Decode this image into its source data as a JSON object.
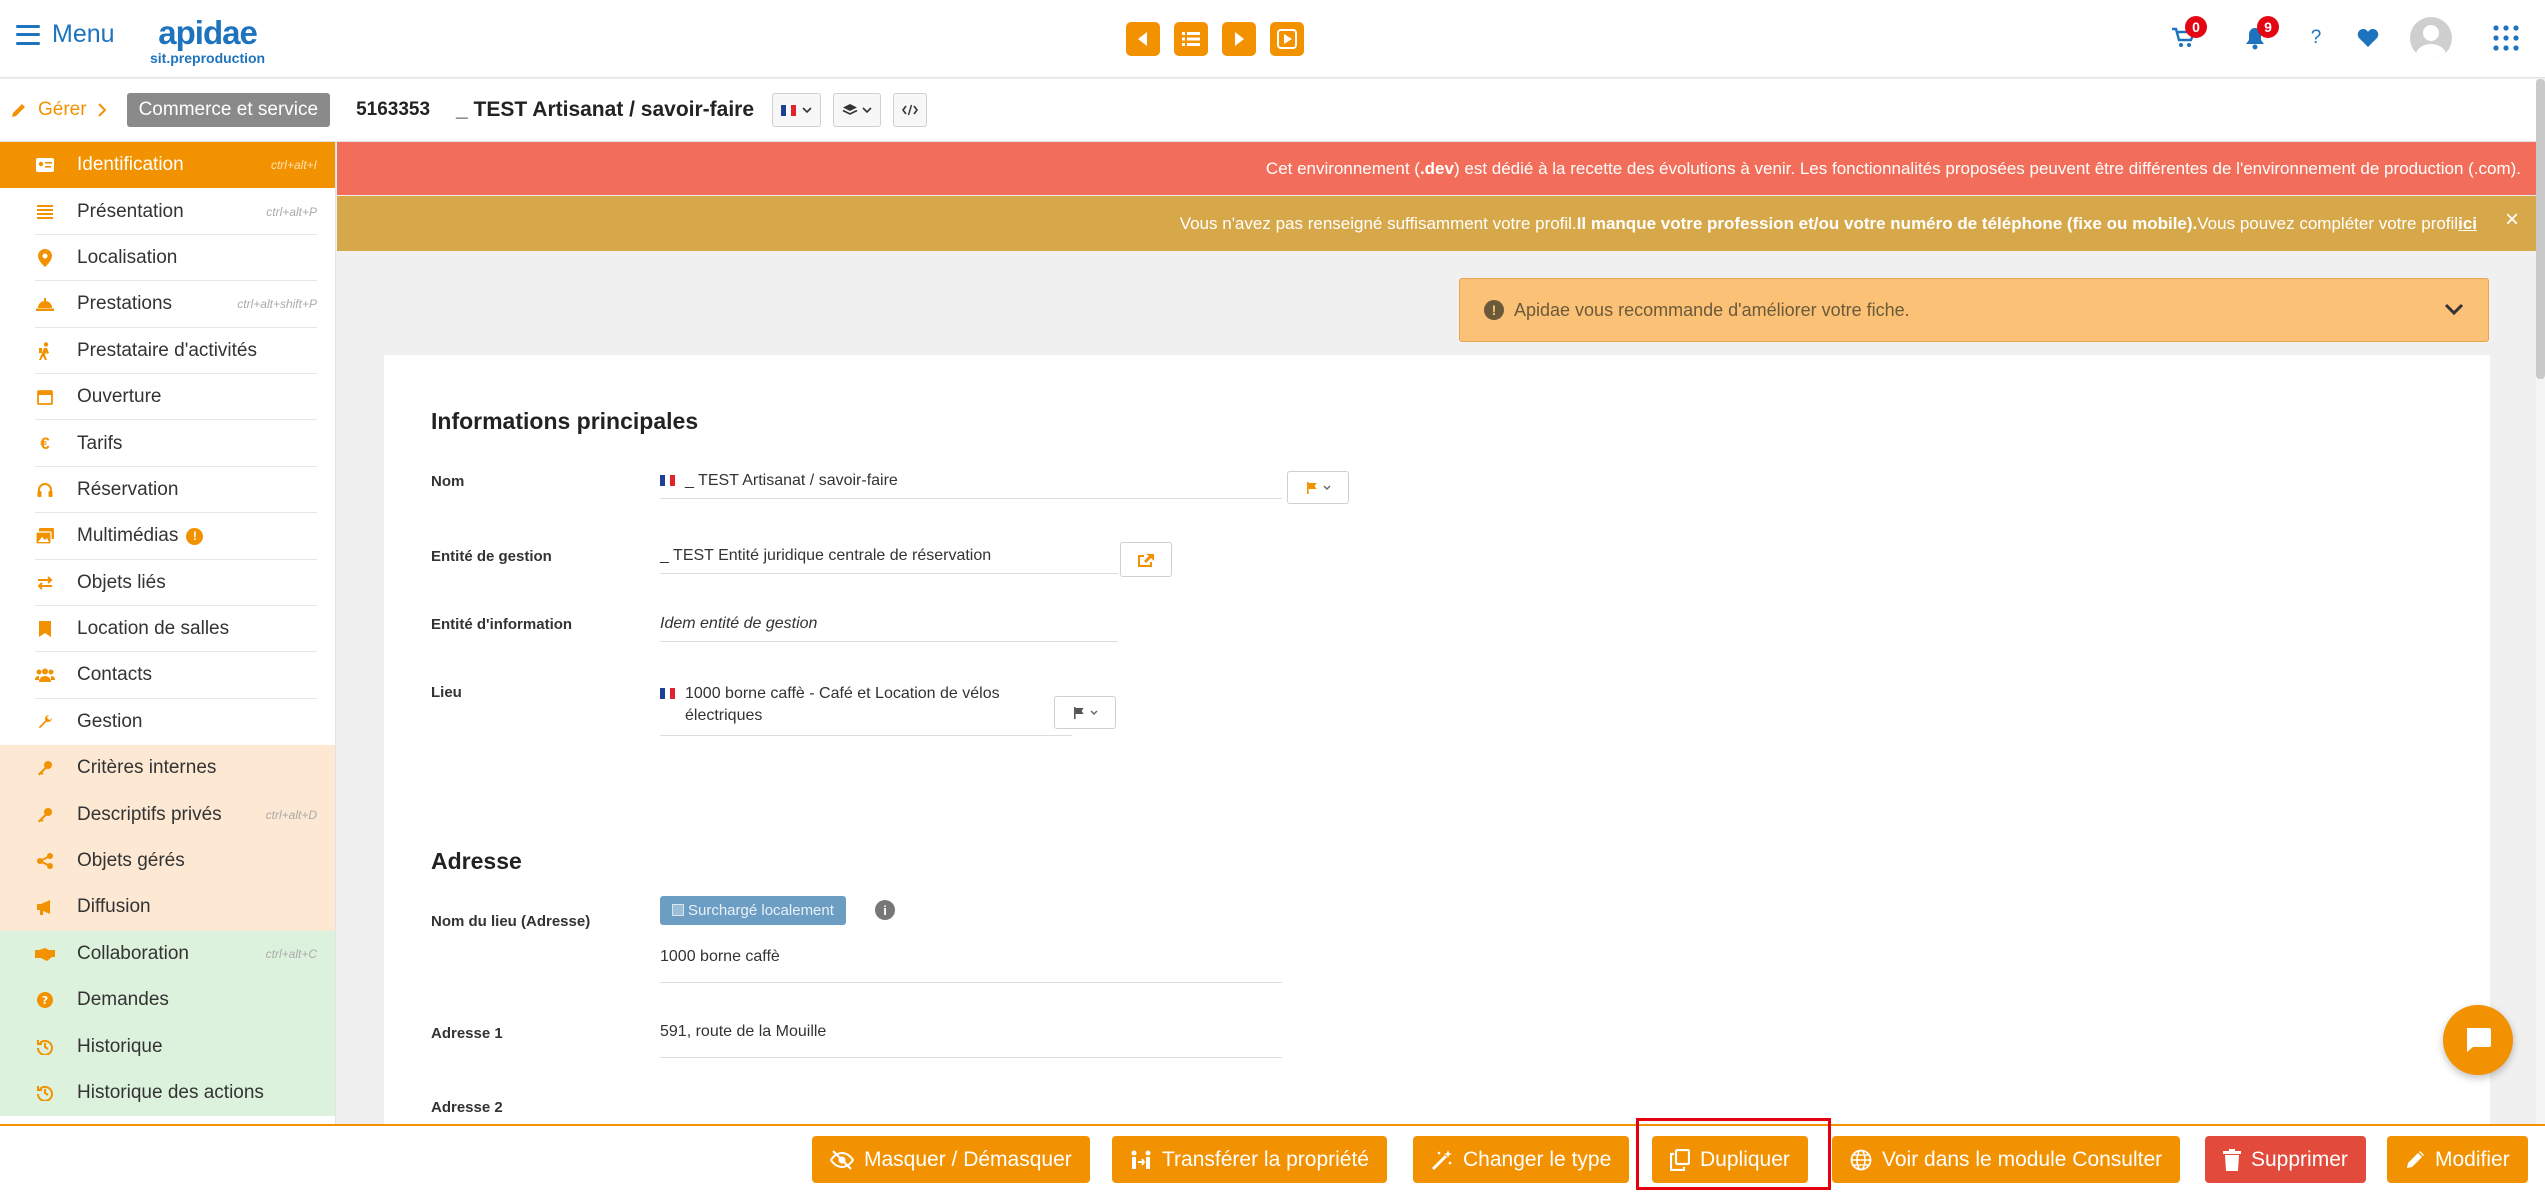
{
  "header": {
    "menu_label": "Menu",
    "logo_main": "apidae",
    "logo_sub": "sit.preproduction",
    "cart_count": "0",
    "notif_count": "9",
    "help_label": "?",
    "brand_color": "#f39200"
  },
  "subheader": {
    "manage_label": "Gérer",
    "type_label": "Commerce et service",
    "object_id": "5163353",
    "object_name": "_ TEST Artisanat / savoir-faire"
  },
  "sidebar": {
    "items": [
      {
        "label": "Identification",
        "shortcut": "ctrl+alt+I"
      },
      {
        "label": "Présentation",
        "shortcut": "ctrl+alt+P"
      },
      {
        "label": "Localisation",
        "shortcut": ""
      },
      {
        "label": "Prestations",
        "shortcut": "ctrl+alt+shift+P"
      },
      {
        "label": "Prestataire d'activités",
        "shortcut": ""
      },
      {
        "label": "Ouverture",
        "shortcut": ""
      },
      {
        "label": "Tarifs",
        "shortcut": ""
      },
      {
        "label": "Réservation",
        "shortcut": ""
      },
      {
        "label": "Multimédias",
        "shortcut": ""
      },
      {
        "label": "Objets liés",
        "shortcut": ""
      },
      {
        "label": "Location de salles",
        "shortcut": ""
      },
      {
        "label": "Contacts",
        "shortcut": ""
      },
      {
        "label": "Gestion",
        "shortcut": ""
      },
      {
        "label": "Critères internes",
        "shortcut": ""
      },
      {
        "label": "Descriptifs privés",
        "shortcut": "ctrl+alt+D"
      },
      {
        "label": "Objets gérés",
        "shortcut": ""
      },
      {
        "label": "Diffusion",
        "shortcut": ""
      },
      {
        "label": "Collaboration",
        "shortcut": "ctrl+alt+C"
      },
      {
        "label": "Demandes",
        "shortcut": ""
      },
      {
        "label": "Historique",
        "shortcut": ""
      },
      {
        "label": "Historique des actions",
        "shortcut": ""
      }
    ],
    "multimedia_badge": "!"
  },
  "banners": {
    "env_pre": "Cet environnement (",
    "env_bold": ".dev",
    "env_post": ") est dédié à la recette des évolutions à venir. Les fonctionnalités proposées peuvent être différentes de l'environnement de production (.com).",
    "profile_pre": "Vous n'avez pas renseigné suffisamment votre profil. ",
    "profile_bold": "Il manque votre profession et/ou votre numéro de téléphone (fixe ou mobile).",
    "profile_post": "Vous pouvez compléter votre profil ",
    "profile_link": "ici",
    "close_label": "×",
    "recommendation": "Apidae vous recommande d'améliorer votre fiche."
  },
  "form": {
    "section_main": "Informations principales",
    "nom_label": "Nom",
    "nom_value": "_ TEST Artisanat / savoir-faire",
    "entite_gestion_label": "Entité de gestion",
    "entite_gestion_value": "_ TEST Entité juridique centrale de réservation",
    "entite_info_label": "Entité d'information",
    "entite_info_value": "Idem entité de gestion",
    "lieu_label": "Lieu",
    "lieu_value": "1000 borne caffè -  Café et Location de vélos électriques",
    "section_address": "Adresse",
    "nom_lieu_label": "Nom du lieu (Adresse)",
    "override_badge": "Surchargé localement",
    "nom_lieu_value": "1000 borne caffè",
    "adresse1_label": "Adresse 1",
    "adresse1_value": "591, route de la Mouille",
    "adresse2_label": "Adresse 2"
  },
  "actions": {
    "masquer": "Masquer / Démasquer",
    "transferer": "Transférer la propriété",
    "changer_type": "Changer le type",
    "dupliquer": "Dupliquer",
    "voir_consulter": "Voir dans le module Consulter",
    "supprimer": "Supprimer",
    "modifier": "Modifier"
  }
}
